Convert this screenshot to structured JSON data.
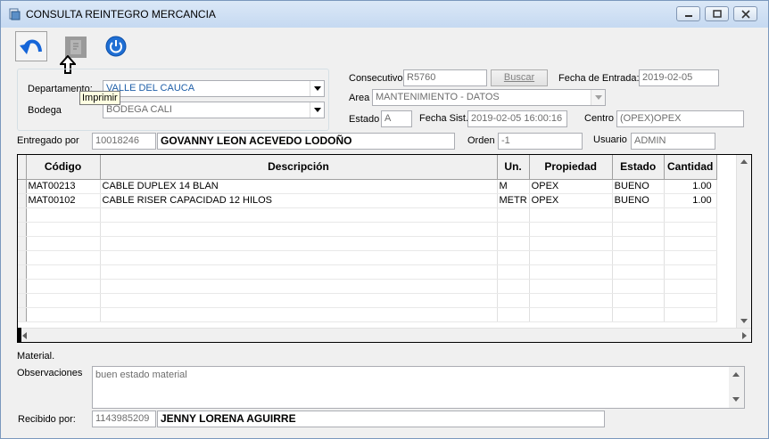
{
  "window": {
    "title": "CONSULTA REINTEGRO MERCANCIA"
  },
  "toolbar": {
    "back_icon": "back-arrow-icon",
    "print_icon": "print-icon",
    "exit_icon": "power-icon",
    "tooltip": "Imprimir"
  },
  "header": {
    "departamento_label": "Departamento:",
    "departamento_value": "VALLE DEL CAUCA",
    "bodega_label": "Bodega",
    "bodega_value": "BODEGA CALI",
    "consecutivo_label": "Consecutivo",
    "consecutivo_value": "R5760",
    "buscar_label": "Buscar",
    "fecha_entrada_label": "Fecha de Entrada:",
    "fecha_entrada_value": "2019-02-05",
    "area_label": "Area",
    "area_value": "MANTENIMIENTO - DATOS",
    "estado_label": "Estado",
    "estado_value": "A",
    "fecha_sist_label": "Fecha Sist.",
    "fecha_sist_value": "2019-02-05 16:00:16",
    "centro_label": "Centro",
    "centro_value": "(OPEX)OPEX",
    "entregado_label": "Entregado por",
    "entregado_id": "10018246",
    "entregado_name": "GOVANNY LEON ACEVEDO LODOÑO",
    "orden_label": "Orden",
    "orden_value": "-1",
    "usuario_label": "Usuario",
    "usuario_value": "ADMIN"
  },
  "grid": {
    "columns": [
      "Código",
      "Descripción",
      "Un.",
      "Propiedad",
      "Estado",
      "Cantidad"
    ],
    "rows": [
      [
        "MAT00213",
        "CABLE DUPLEX 14 BLAN",
        "M",
        "OPEX",
        "BUENO",
        "1.00"
      ],
      [
        "MAT00102",
        "CABLE RISER CAPACIDAD 12 HILOS",
        "METR",
        "OPEX",
        "BUENO",
        "1.00"
      ]
    ]
  },
  "footer": {
    "material_label": "Material.",
    "observaciones_label": "Observaciones",
    "observaciones_value": "buen estado material",
    "recibido_label": "Recibido por:",
    "recibido_id": "1143985209",
    "recibido_name": "JENNY LORENA AGUIRRE"
  },
  "colors": {
    "accent_blue": "#1f5fa8",
    "tooltip_bg": "#ffffe1",
    "titlebar": "#c5d9f1"
  }
}
